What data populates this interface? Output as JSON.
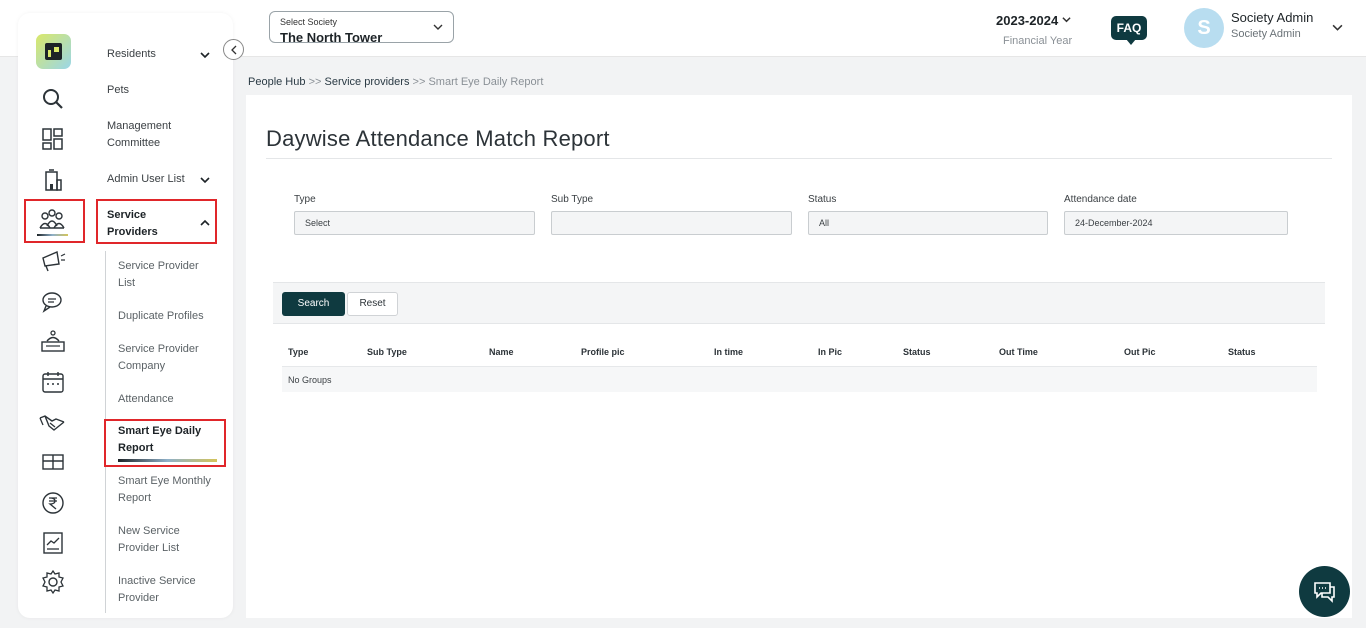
{
  "header": {
    "society_label": "Select Society",
    "society_value": "The North Tower",
    "financial_year": "2023-2024",
    "financial_year_label": "Financial Year",
    "faq": "FAQ",
    "avatar_initial": "S",
    "user_name": "Society Admin",
    "user_role": "Society Admin"
  },
  "sidebar": {
    "icons": [
      "search-icon",
      "dashboard-icon",
      "building-icon",
      "people-icon",
      "megaphone-icon",
      "chat-icon",
      "desk-icon",
      "calendar-icon",
      "handshake-icon",
      "gift-icon",
      "rupee-icon",
      "report-icon",
      "gear-icon"
    ],
    "menu": {
      "residents": "Residents",
      "pets": "Pets",
      "management_committee": "Management Committee",
      "admin_user_list": "Admin User List",
      "service_providers": "Service Providers"
    },
    "submenu": {
      "service_provider_list": "Service Provider List",
      "duplicate_profiles": "Duplicate Profiles",
      "service_provider_company": "Service Provider Company",
      "attendance": "Attendance",
      "smart_eye_daily_report": "Smart Eye Daily Report",
      "smart_eye_monthly_report": "Smart Eye Monthly Report",
      "new_service_provider_list": "New Service Provider List",
      "inactive_service_provider": "Inactive Service Provider"
    }
  },
  "breadcrumb": {
    "c1": "People Hub",
    "sep": ">>",
    "c2": "Service providers",
    "c3": "Smart Eye Daily Report"
  },
  "main": {
    "title": "Daywise Attendance Match Report",
    "filters": {
      "type_label": "Type",
      "type_value": "Select",
      "subtype_label": "Sub Type",
      "subtype_value": "",
      "status_label": "Status",
      "status_value": "All",
      "date_label": "Attendance date",
      "date_value": "24-December-2024"
    },
    "buttons": {
      "search": "Search",
      "reset": "Reset"
    },
    "table": {
      "columns": [
        "Type",
        "Sub Type",
        "Name",
        "Profile pic",
        "In time",
        "In Pic",
        "Status",
        "Out Time",
        "Out Pic",
        "Status"
      ],
      "empty": "No Groups"
    }
  },
  "colors": {
    "accent": "#0f3a40",
    "highlight": "#e0262a"
  }
}
